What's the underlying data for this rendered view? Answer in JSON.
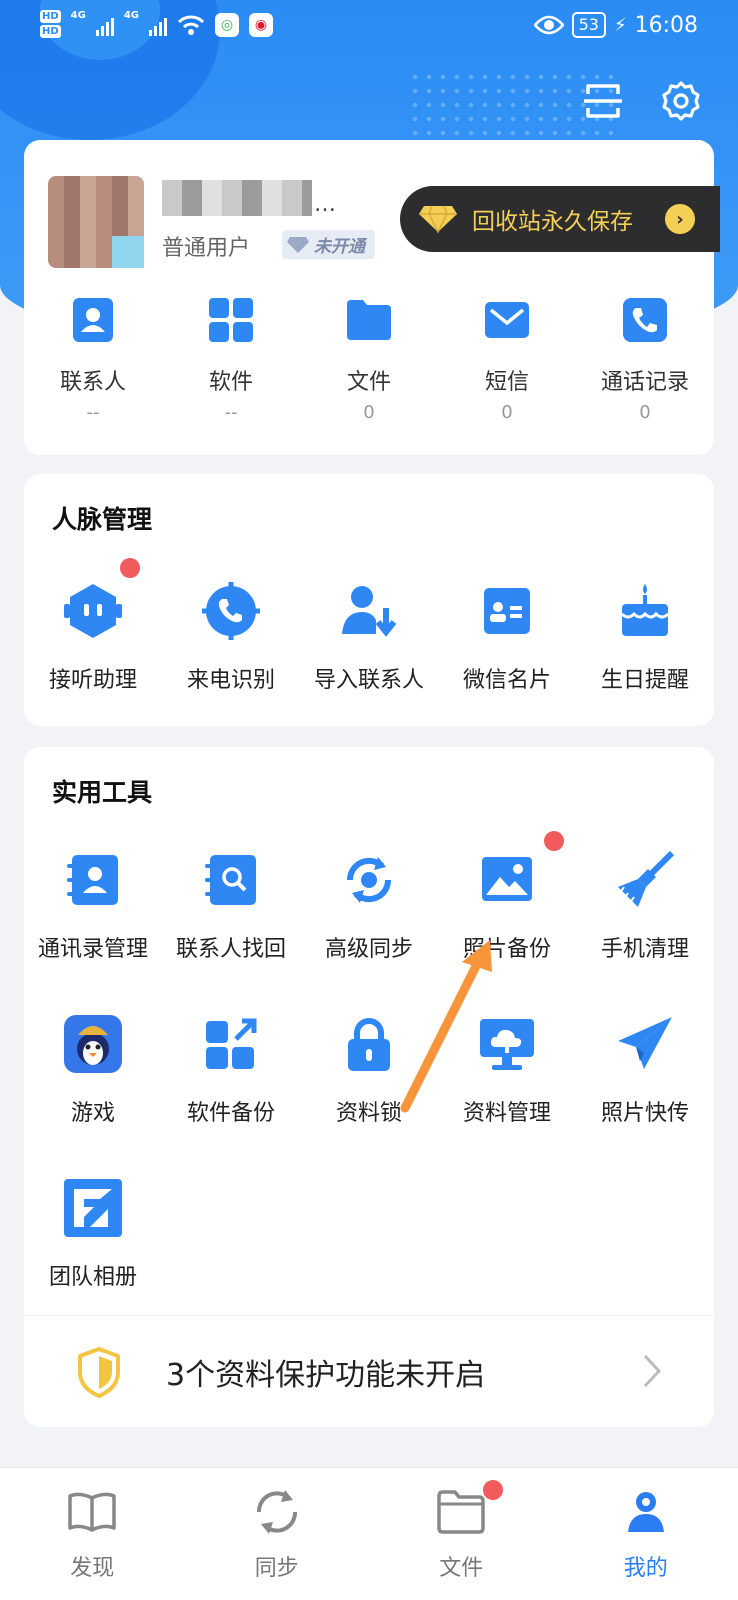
{
  "status_bar": {
    "time": "16:08",
    "battery": "53",
    "sim1": "HD",
    "sim2": "HD",
    "sim1_net": "4G",
    "sim2_net": "4G"
  },
  "header": {
    "icons": [
      "scan-icon",
      "gear-icon"
    ]
  },
  "profile": {
    "user_type": "普通用户",
    "vip_status": "未开通",
    "recycle_banner": "回收站永久保存",
    "stats": [
      {
        "label": "联系人",
        "value": "--",
        "icon": "contact-icon"
      },
      {
        "label": "软件",
        "value": "--",
        "icon": "apps-icon"
      },
      {
        "label": "文件",
        "value": "0",
        "icon": "folder-icon"
      },
      {
        "label": "短信",
        "value": "0",
        "icon": "sms-icon"
      },
      {
        "label": "通话记录",
        "value": "0",
        "icon": "phone-icon"
      }
    ]
  },
  "network_section": {
    "title": "人脉管理",
    "items": [
      {
        "label": "接听助理",
        "icon": "assistant-icon",
        "badge": true
      },
      {
        "label": "来电识别",
        "icon": "caller-id-icon"
      },
      {
        "label": "导入联系人",
        "icon": "import-contacts-icon"
      },
      {
        "label": "微信名片",
        "icon": "business-card-icon"
      },
      {
        "label": "生日提醒",
        "icon": "birthday-cake-icon"
      }
    ]
  },
  "tools_section": {
    "title": "实用工具",
    "items": [
      {
        "label": "通讯录管理",
        "icon": "address-book-icon"
      },
      {
        "label": "联系人找回",
        "icon": "contact-recover-icon"
      },
      {
        "label": "高级同步",
        "icon": "sync-icon"
      },
      {
        "label": "照片备份",
        "icon": "photo-backup-icon",
        "badge": true
      },
      {
        "label": "手机清理",
        "icon": "broom-icon"
      },
      {
        "label": "游戏",
        "icon": "game-icon"
      },
      {
        "label": "软件备份",
        "icon": "app-backup-icon"
      },
      {
        "label": "资料锁",
        "icon": "lock-icon"
      },
      {
        "label": "资料管理",
        "icon": "cloud-monitor-icon"
      },
      {
        "label": "照片快传",
        "icon": "paper-plane-icon"
      },
      {
        "label": "团队相册",
        "icon": "team-album-icon"
      }
    ],
    "protect_text": "3个资料保护功能未开启"
  },
  "tabbar": {
    "tabs": [
      {
        "label": "发现",
        "icon": "book-icon"
      },
      {
        "label": "同步",
        "icon": "sync-tab-icon"
      },
      {
        "label": "文件",
        "icon": "folder-tab-icon",
        "badge": true
      },
      {
        "label": "我的",
        "icon": "profile-tab-icon",
        "active": true
      }
    ]
  },
  "colors": {
    "primary": "#2a7ef2",
    "header_bg": "#2a8cf4",
    "badge": "#f15b5b",
    "gold": "#f4cf55"
  }
}
